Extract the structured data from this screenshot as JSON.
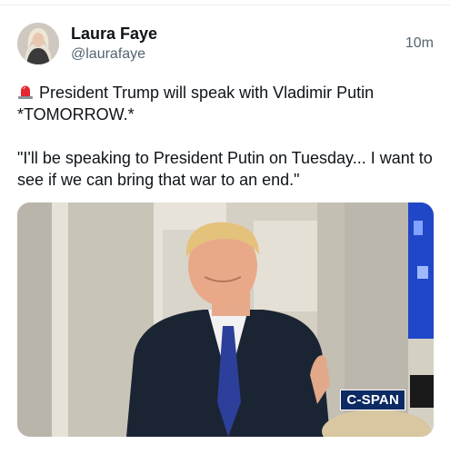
{
  "post": {
    "author": {
      "display_name": "Laura Faye",
      "handle": "@laurafaye"
    },
    "timestamp": "10m",
    "text_line1": "President Trump will speak with Vladimir Putin",
    "text_line2": "*TOMORROW.*",
    "text_quote": "\"I'll be speaking to President Putin on Tuesday... I want to see if we can bring that war to an end.\"",
    "leading_icon": "rotating-light-icon",
    "media": {
      "type": "video-still",
      "watermark": "C-SPAN"
    }
  },
  "colors": {
    "text_primary": "#0f1419",
    "text_secondary": "#536471",
    "cspan_blue": "#0c2a63"
  }
}
